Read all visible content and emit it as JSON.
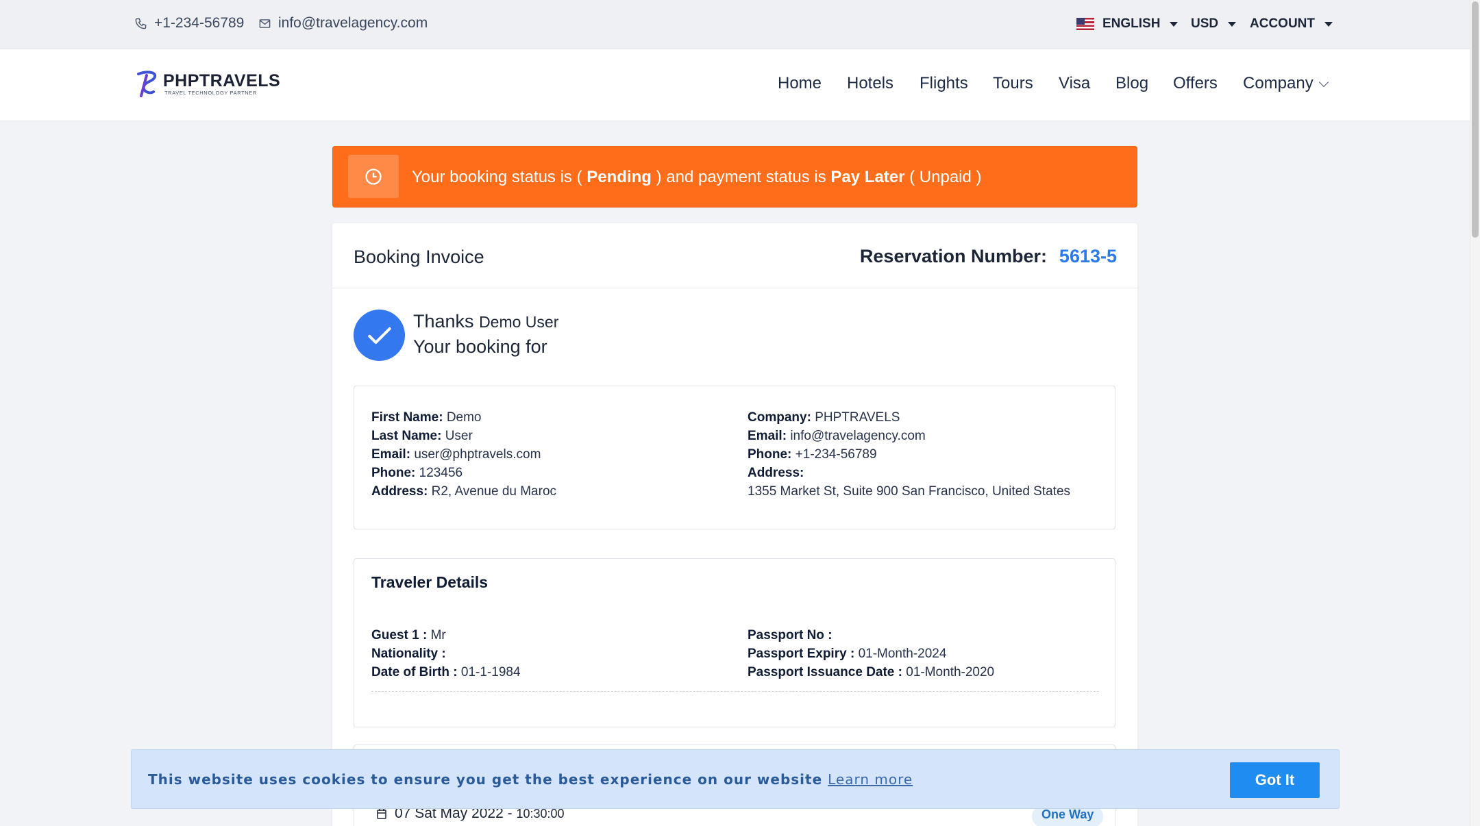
{
  "topbar": {
    "phone": "+1-234-56789",
    "email": "info@travelagency.com",
    "language": "ENGLISH",
    "currency": "USD",
    "account": "ACCOUNT"
  },
  "navbar": {
    "logo_main": "PHPTRAVELS",
    "logo_sub": "TRAVEL TECHNOLOGY PARTNER",
    "links": [
      "Home",
      "Hotels",
      "Flights",
      "Tours",
      "Visa",
      "Blog",
      "Offers",
      "Company"
    ]
  },
  "status": {
    "prefix": "Your booking status is ( ",
    "booking_status": "Pending",
    "middle": " ) and payment status is ",
    "payment_method": "Pay Later",
    "suffix": " ( Unpaid )"
  },
  "invoice": {
    "title": "Booking Invoice",
    "reservation_label": "Reservation Number:",
    "reservation_number": "5613-5",
    "thanks": "Thanks",
    "user_name": "Demo User",
    "booking_for": "Your booking for"
  },
  "customer": {
    "first_name_label": "First Name:",
    "first_name": "Demo",
    "last_name_label": "Last Name:",
    "last_name": "User",
    "email_label": "Email:",
    "email": "user@phptravels.com",
    "phone_label": "Phone:",
    "phone": "123456",
    "address_label": "Address:",
    "address": "R2, Avenue du Maroc"
  },
  "company": {
    "company_label": "Company:",
    "company": "PHPTRAVELS",
    "email_label": "Email:",
    "email": "info@travelagency.com",
    "phone_label": "Phone:",
    "phone": "+1-234-56789",
    "address_label": "Address:",
    "address": "1355 Market St, Suite 900 San Francisco, United States"
  },
  "traveler": {
    "title": "Traveler Details",
    "guest_label": "Guest 1 :",
    "guest": "Mr",
    "nationality_label": "Nationality :",
    "nationality": "",
    "dob_label": "Date of Birth :",
    "dob": "01-1-1984",
    "passport_no_label": "Passport No :",
    "passport_no": "",
    "passport_expiry_label": "Passport Expiry :",
    "passport_expiry": "01-Month-2024",
    "passport_issuance_label": "Passport Issuance Date :",
    "passport_issuance": "01-Month-2020"
  },
  "flight": {
    "date": "07 Sat May 2022",
    "separator": " - ",
    "time": "10:30:00",
    "trip_type": "One Way"
  },
  "cookie": {
    "message": "This website uses cookies to ensure you get the best experience on our website",
    "learn_more": "Learn more",
    "button": "Got It"
  },
  "colors": {
    "status_bg": "#ff6d1a",
    "accent_blue": "#2d7bea",
    "cookie_bg": "#d4e5fb",
    "button_blue": "#1f8cf2"
  },
  "icons": [
    "phone-icon",
    "mail-icon",
    "us-flag-icon",
    "clock-icon",
    "check-icon",
    "calendar-icon",
    "chevron-down-icon"
  ]
}
